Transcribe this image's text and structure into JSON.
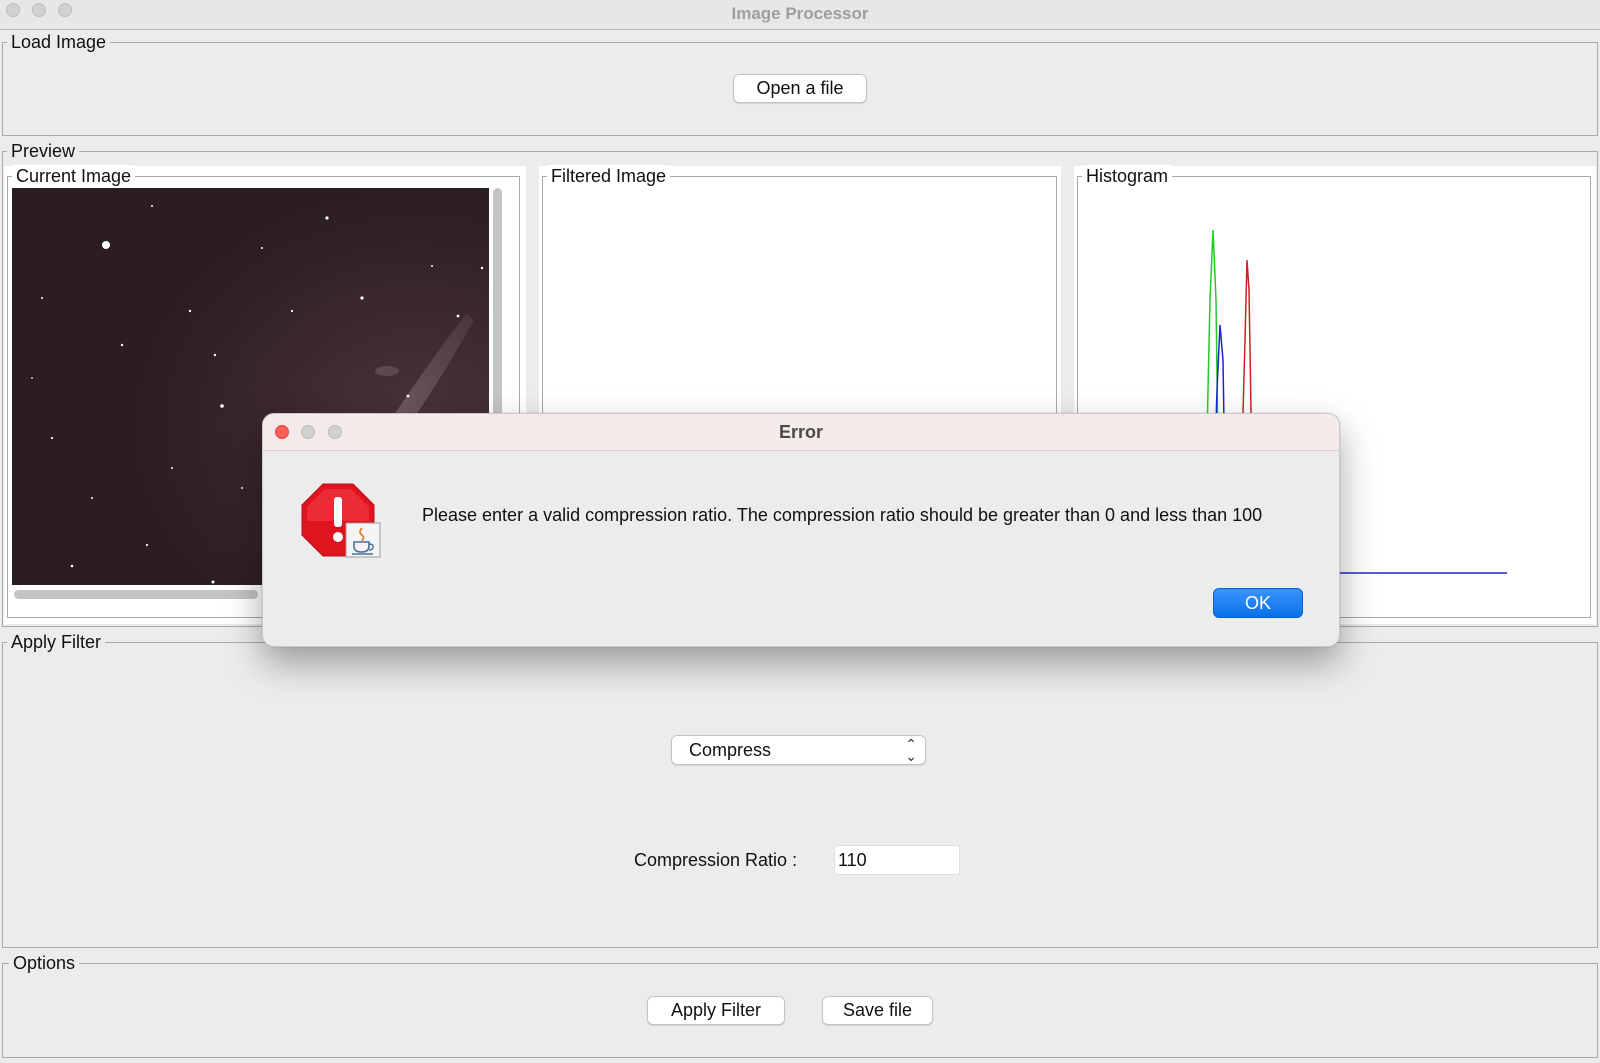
{
  "window": {
    "title": "Image Processor"
  },
  "load_image": {
    "legend": "Load Image",
    "open_button": "Open a file"
  },
  "preview": {
    "legend": "Preview",
    "current_image": {
      "legend": "Current Image"
    },
    "filtered_image": {
      "legend": "Filtered Image"
    },
    "histogram": {
      "legend": "Histogram"
    }
  },
  "apply_filter": {
    "legend": "Apply Filter",
    "filter_select": {
      "selected": "Compress"
    },
    "ratio_label": "Compression Ratio :",
    "ratio_value": "110"
  },
  "options": {
    "legend": "Options",
    "apply_button": "Apply Filter",
    "save_button": "Save file"
  },
  "dialog": {
    "title": "Error",
    "message": "Please enter a valid compression ratio. The compression ratio should be greater than 0 and less than 100",
    "ok_button": "OK"
  },
  "colors": {
    "histogram_green": "#22cc22",
    "histogram_blue": "#2222cc",
    "histogram_red": "#cc2222",
    "error_icon": "#e0141e",
    "ok_button": "#0a72eb"
  },
  "icons": {
    "error": "error-octagon-icon",
    "java": "java-cup-icon"
  }
}
